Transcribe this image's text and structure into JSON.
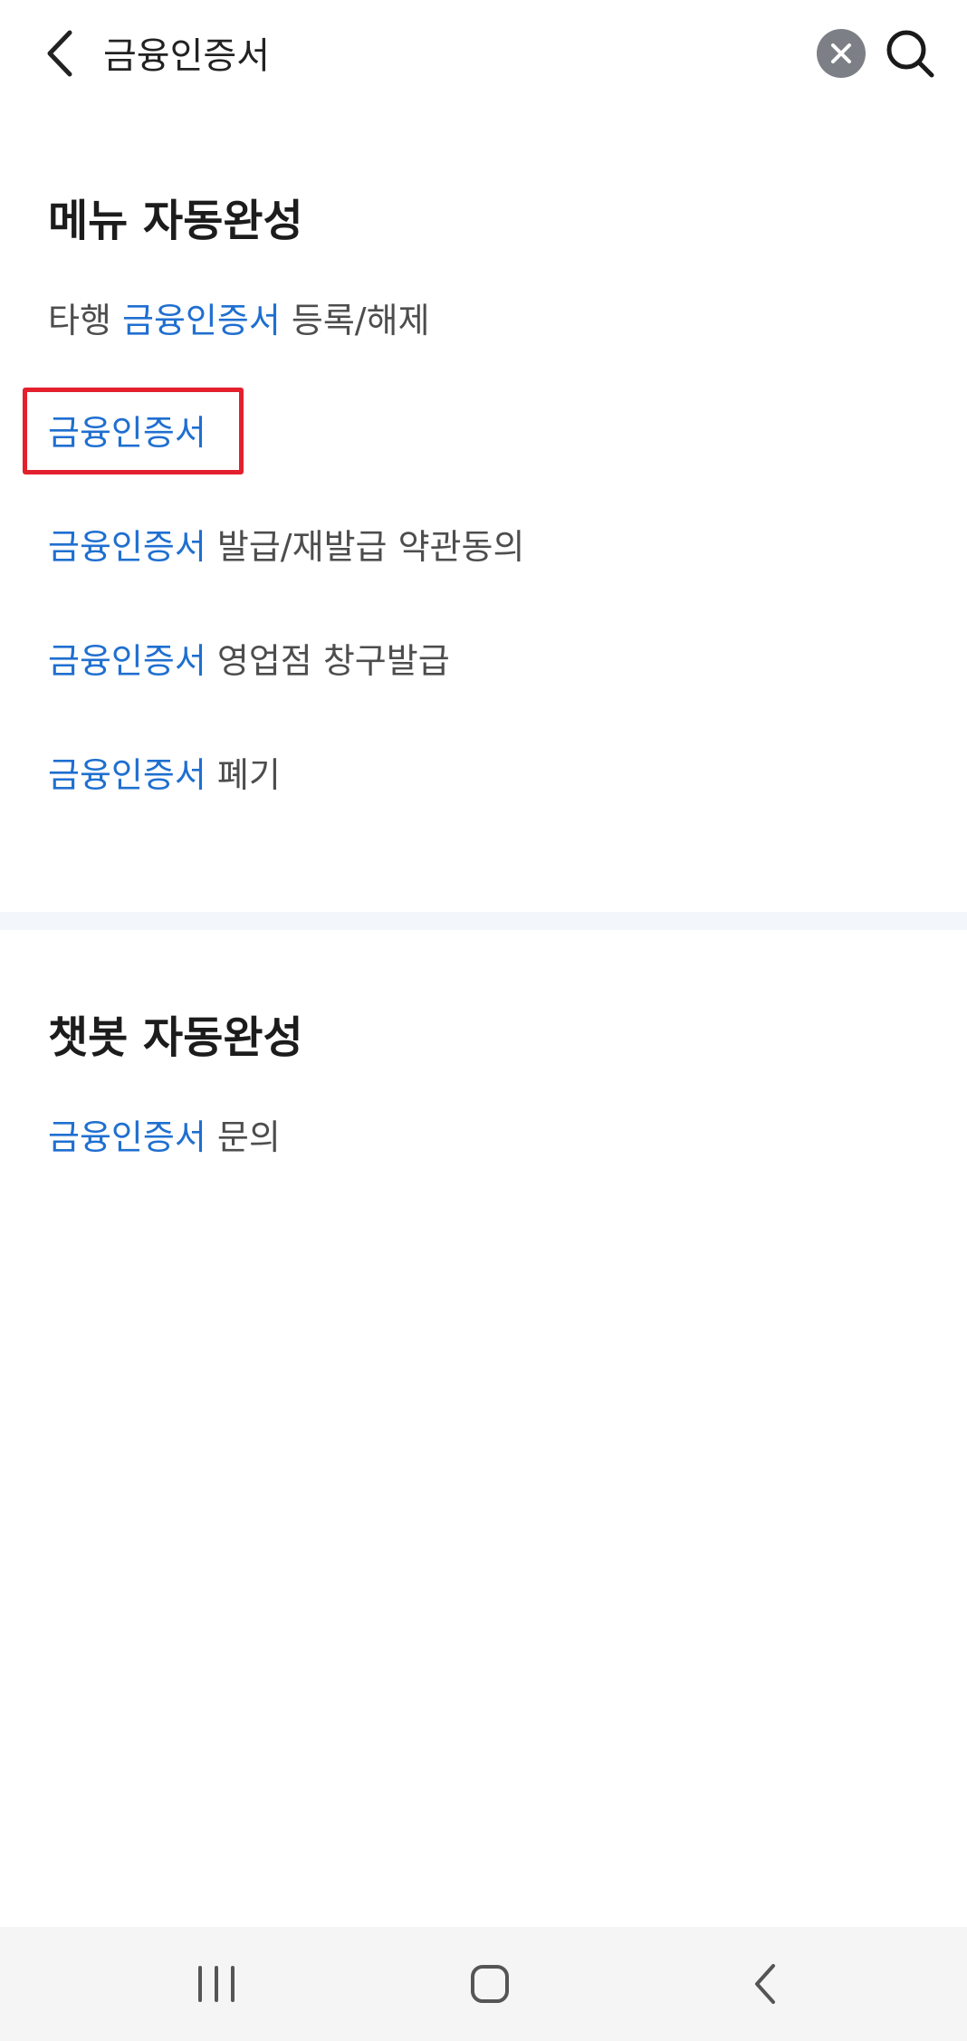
{
  "search": {
    "value": "금융인증서"
  },
  "menu_section": {
    "title": "메뉴 자동완성",
    "items": [
      {
        "prefix": "타행 ",
        "highlight": "금융인증서",
        "suffix": " 등록/해제"
      },
      {
        "prefix": "",
        "highlight": "금융인증서",
        "suffix": ""
      },
      {
        "prefix": "",
        "highlight": "금융인증서",
        "suffix": " 발급/재발급 약관동의"
      },
      {
        "prefix": "",
        "highlight": "금융인증서",
        "suffix": " 영업점 창구발급"
      },
      {
        "prefix": "",
        "highlight": "금융인증서",
        "suffix": " 폐기"
      }
    ]
  },
  "chatbot_section": {
    "title": "챗봇 자동완성",
    "items": [
      {
        "prefix": "",
        "highlight": "금융인증서",
        "suffix": " 문의"
      }
    ]
  },
  "icons": {
    "back": "chevron-left-icon",
    "clear": "close-circle-icon",
    "search": "search-icon",
    "nav_recent": "recent-apps-icon",
    "nav_home": "home-icon",
    "nav_back": "back-icon"
  },
  "colors": {
    "highlight": "#1f6fd0",
    "selection_box": "#e3202d",
    "divider": "#f3f6fa"
  }
}
